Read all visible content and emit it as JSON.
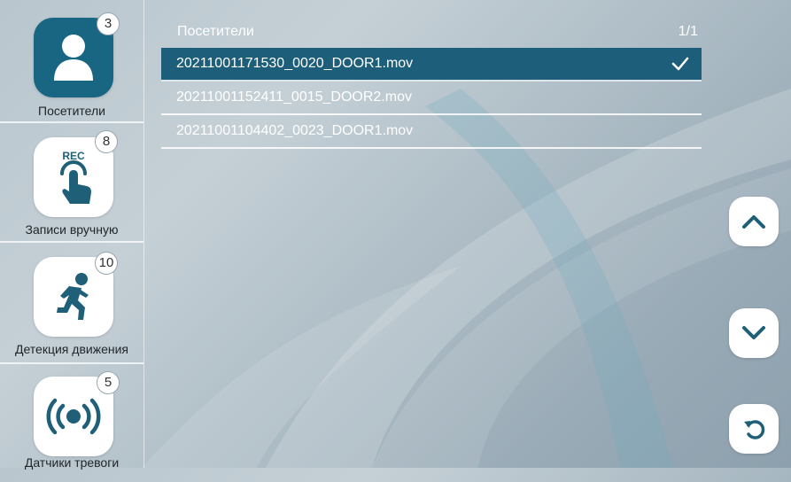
{
  "sidebar": {
    "items": [
      {
        "label": "Посетители",
        "badge": "3",
        "icon": "person-icon",
        "active": true
      },
      {
        "label": "Записи вручную",
        "badge": "8",
        "icon": "rec-hand-icon",
        "icon_text": "REC"
      },
      {
        "label": "Детекция движения",
        "badge": "10",
        "icon": "running-man-icon"
      },
      {
        "label": "Датчики тревоги",
        "badge": "5",
        "icon": "alarm-signal-icon"
      }
    ]
  },
  "list": {
    "title": "Посетители",
    "page": "1/1",
    "files": [
      {
        "name": "20211001171530_0020_DOOR1.mov",
        "selected": true
      },
      {
        "name": "20211001152411_0015_DOOR2.mov",
        "selected": false
      },
      {
        "name": "20211001104402_0023_DOOR1.mov",
        "selected": false
      }
    ]
  },
  "controls": {
    "up": "chevron-up-icon",
    "down": "chevron-down-icon",
    "back": "back-arrow-icon"
  },
  "colors": {
    "accent": "#196683",
    "selected_row": "#1d5f7b",
    "tile": "#ffffff",
    "icon_dark": "#1f5f78"
  }
}
